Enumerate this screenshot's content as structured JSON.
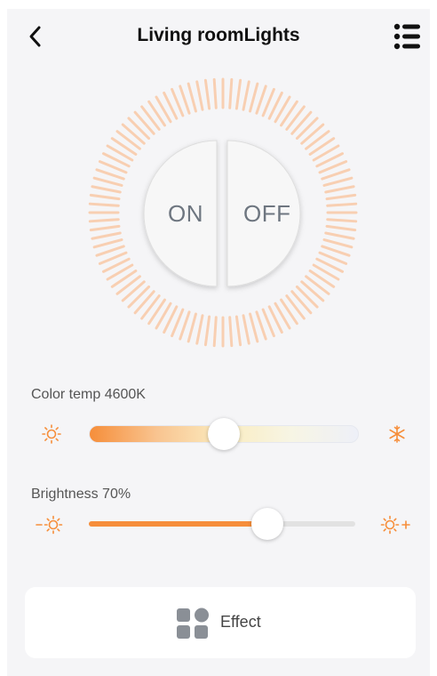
{
  "header": {
    "title": "Living roomLights",
    "back_icon": "chevron-left-icon",
    "menu_icon": "list-menu-icon"
  },
  "power": {
    "on_label": "ON",
    "off_label": "OFF",
    "ring_color": "#f9c39b"
  },
  "color_temp": {
    "label": "Color temp 4600K",
    "level": 0.5,
    "warm_icon": "sun-icon",
    "cool_icon": "snowflake-icon",
    "warm_color": "#f68e3a",
    "cool_color": "#f0f2f8"
  },
  "brightness": {
    "label": "Brightness 70%",
    "level": 0.67,
    "decrease_icon": "brightness-down-icon",
    "increase_icon": "brightness-up-icon",
    "fill_color": "#f68e3a",
    "track_color": "#e2e2e2"
  },
  "effect": {
    "label": "Effect",
    "icon": "grid-shapes-icon"
  }
}
